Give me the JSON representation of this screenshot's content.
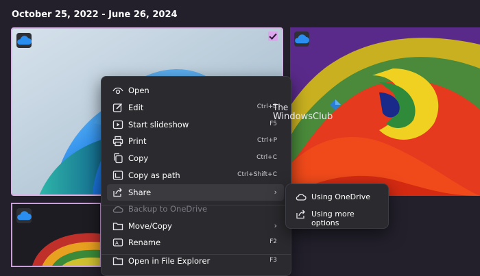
{
  "date_range": "October 25, 2022 - June 26, 2024",
  "watermark": {
    "line1": "The",
    "line2": "WindowsClub"
  },
  "context_menu": [
    {
      "label": "Open",
      "shortcut": "",
      "icon": "eye-icon"
    },
    {
      "label": "Edit",
      "shortcut": "Ctrl+E",
      "icon": "edit-icon"
    },
    {
      "label": "Start slideshow",
      "shortcut": "F5",
      "icon": "slideshow-icon"
    },
    {
      "label": "Print",
      "shortcut": "Ctrl+P",
      "icon": "printer-icon"
    },
    {
      "label": "Copy",
      "shortcut": "Ctrl+C",
      "icon": "copy-icon"
    },
    {
      "label": "Copy as path",
      "shortcut": "Ctrl+Shift+C",
      "icon": "copy-path-icon"
    },
    {
      "label": "Share",
      "shortcut": "",
      "icon": "share-icon",
      "submenu": true
    },
    {
      "label": "Backup to OneDrive",
      "shortcut": "",
      "icon": "cloud-icon",
      "disabled": true
    },
    {
      "label": "Move/Copy",
      "shortcut": "",
      "icon": "move-icon",
      "submenu": true
    },
    {
      "label": "Rename",
      "shortcut": "F2",
      "icon": "rename-icon"
    },
    {
      "label": "Open in File Explorer",
      "shortcut": "F3",
      "icon": "folder-icon"
    }
  ],
  "share_submenu": [
    {
      "label": "Using OneDrive",
      "icon": "onedrive-icon"
    },
    {
      "label": "Using more options",
      "icon": "share-icon"
    }
  ],
  "colors": {
    "background": "#23202c",
    "menu": "#2b2b2f",
    "selection_border": "#d9b2e6"
  }
}
